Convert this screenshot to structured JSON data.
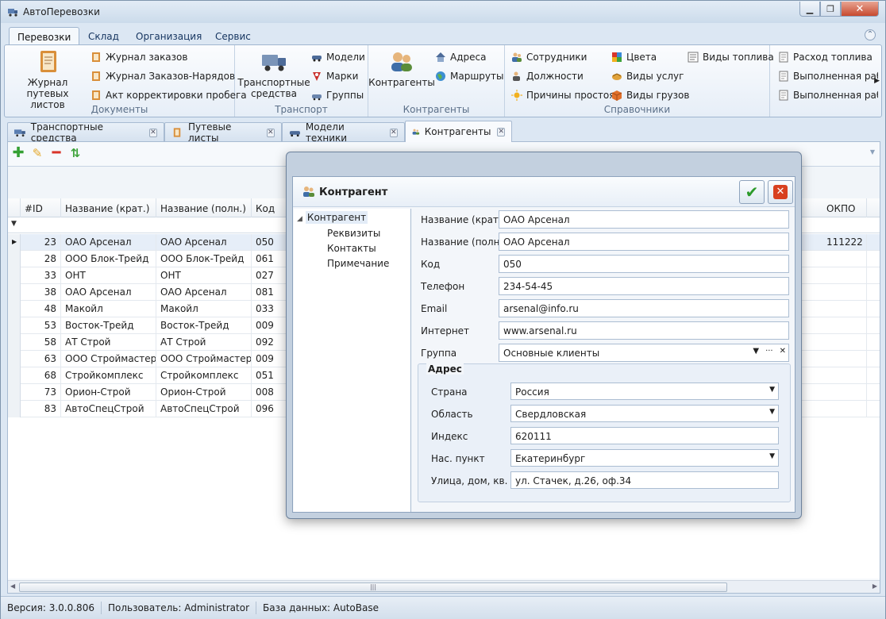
{
  "window": {
    "title": "АвтоПеревозки"
  },
  "ribbon_tabs": [
    {
      "label": "Перевозки"
    },
    {
      "label": "Склад"
    },
    {
      "label": "Организация"
    },
    {
      "label": "Сервис"
    }
  ],
  "ribbon": {
    "groups": {
      "documents": {
        "label": "Документы",
        "big": "Журнал путевых листов",
        "small": [
          "Журнал заказов",
          "Журнал Заказов-Нарядов",
          "Акт корректировки пробега"
        ]
      },
      "transport": {
        "label": "Транспорт",
        "big": "Транспортные средства",
        "small": [
          "Модели",
          "Марки",
          "Группы"
        ]
      },
      "contractors": {
        "label": "Контрагенты",
        "big": "Контрагенты",
        "small": [
          "Адреса",
          "Маршруты"
        ]
      },
      "references": {
        "label": "Справочники",
        "col1": [
          "Сотрудники",
          "Должности",
          "Причины простоя"
        ],
        "col2": [
          "Цвета",
          "Виды услуг",
          "Виды грузов"
        ],
        "col3": [
          "Виды топлива"
        ]
      },
      "extra": {
        "items": [
          "Расход топлива",
          "Выполненная рабо",
          "Выполненная рабо"
        ]
      }
    }
  },
  "doc_tabs": [
    {
      "label": "Транспортные средства"
    },
    {
      "label": "Путевые листы"
    },
    {
      "label": "Модели техники"
    },
    {
      "label": "Контрагенты"
    }
  ],
  "grid": {
    "columns": [
      "#ID",
      "Название (крат.)",
      "Название (полн.)",
      "Код",
      "ОКПО"
    ],
    "rows": [
      {
        "id": "23",
        "short": "ОАО Арсенал",
        "full": "ОАО Арсенал",
        "code": "050",
        "okpo": "111222"
      },
      {
        "id": "28",
        "short": "ООО Блок-Трейд",
        "full": "ООО Блок-Трейд",
        "code": "061",
        "okpo": ""
      },
      {
        "id": "33",
        "short": "ОНТ",
        "full": "ОНТ",
        "code": "027",
        "okpo": ""
      },
      {
        "id": "38",
        "short": "ОАО Арсенал",
        "full": "ОАО Арсенал",
        "code": "081",
        "okpo": ""
      },
      {
        "id": "48",
        "short": "Макойл",
        "full": "Макойл",
        "code": "033",
        "okpo": ""
      },
      {
        "id": "53",
        "short": "Восток-Трейд",
        "full": "Восток-Трейд",
        "code": "009",
        "okpo": ""
      },
      {
        "id": "58",
        "short": "АТ Строй",
        "full": "АТ Строй",
        "code": "092",
        "okpo": ""
      },
      {
        "id": "63",
        "short": "ООО Строймастер",
        "full": "ООО Строймастер",
        "code": "009",
        "okpo": ""
      },
      {
        "id": "68",
        "short": "Стройкомплекс",
        "full": "Стройкомплекс",
        "code": "051",
        "okpo": ""
      },
      {
        "id": "73",
        "short": "Орион-Строй",
        "full": "Орион-Строй",
        "code": "008",
        "okpo": ""
      },
      {
        "id": "83",
        "short": "АвтоСпецСтрой",
        "full": "АвтоСпецСтрой",
        "code": "096",
        "okpo": ""
      }
    ],
    "filter_icon": "filter-icon",
    "scroll_mark": "|||"
  },
  "dialog": {
    "title": "Контрагент",
    "tree": {
      "root": "Контрагент",
      "children": [
        "Реквизиты",
        "Контакты",
        "Примечание"
      ]
    },
    "fields": [
      {
        "label": "Название (крат.)",
        "value": "ОАО Арсенал"
      },
      {
        "label": "Название (полн.)",
        "value": "ОАО Арсенал"
      },
      {
        "label": "Код",
        "value": "050"
      },
      {
        "label": "Телефон",
        "value": "234-54-45"
      },
      {
        "label": "Email",
        "value": "arsenal@info.ru"
      },
      {
        "label": "Интернет",
        "value": "www.arsenal.ru"
      },
      {
        "label": "Группа",
        "value": "Основные клиенты"
      }
    ],
    "address": {
      "title": "Адрес",
      "fields": [
        {
          "label": "Страна",
          "value": "Россия"
        },
        {
          "label": "Область",
          "value": "Свердловская"
        },
        {
          "label": "Индекс",
          "value": "620111"
        },
        {
          "label": "Нас. пункт",
          "value": "Екатеринбург"
        },
        {
          "label": "Улица, дом, кв.",
          "value": "ул. Стачек, д.26, оф.34"
        }
      ]
    }
  },
  "status": {
    "version": "Версия: 3.0.0.806",
    "user": "Пользователь: Administrator",
    "db": "База данных: AutoBase"
  },
  "colors": {
    "accent": "#3c6fb0",
    "ok": "#2c9a2a",
    "cancel": "#d8401f",
    "add": "#34a033",
    "delete": "#d9352a"
  }
}
